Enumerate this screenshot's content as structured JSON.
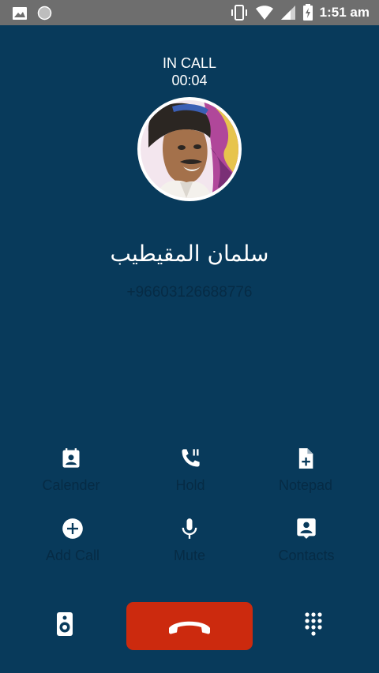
{
  "status_bar": {
    "time": "1:51 am",
    "left_icons": [
      "image-icon",
      "circle-icon"
    ],
    "right_icons": [
      "vibrate-icon",
      "wifi-icon",
      "signal-icon",
      "battery-charging-icon"
    ]
  },
  "call": {
    "state": "IN CALL",
    "timer": "00:04"
  },
  "contact": {
    "name": "سلمان المقيطيب",
    "number": "+96603126688776"
  },
  "actions": [
    {
      "label": "Calender",
      "icon": "calendar-contact-icon"
    },
    {
      "label": "Hold",
      "icon": "phone-pause-icon"
    },
    {
      "label": "Notepad",
      "icon": "note-add-icon"
    },
    {
      "label": "Add Call",
      "icon": "add-circle-icon"
    },
    {
      "label": "Mute",
      "icon": "microphone-icon"
    },
    {
      "label": "Contacts",
      "icon": "contact-card-icon"
    }
  ],
  "bottom": {
    "left_icon": "speaker-icon",
    "center_icon": "end-call-icon",
    "right_icon": "dialpad-icon"
  },
  "colors": {
    "background": "#083a5b",
    "status_bar": "#6e6e6e",
    "end_call": "#cc2a0e",
    "label_text": "#062b45"
  }
}
